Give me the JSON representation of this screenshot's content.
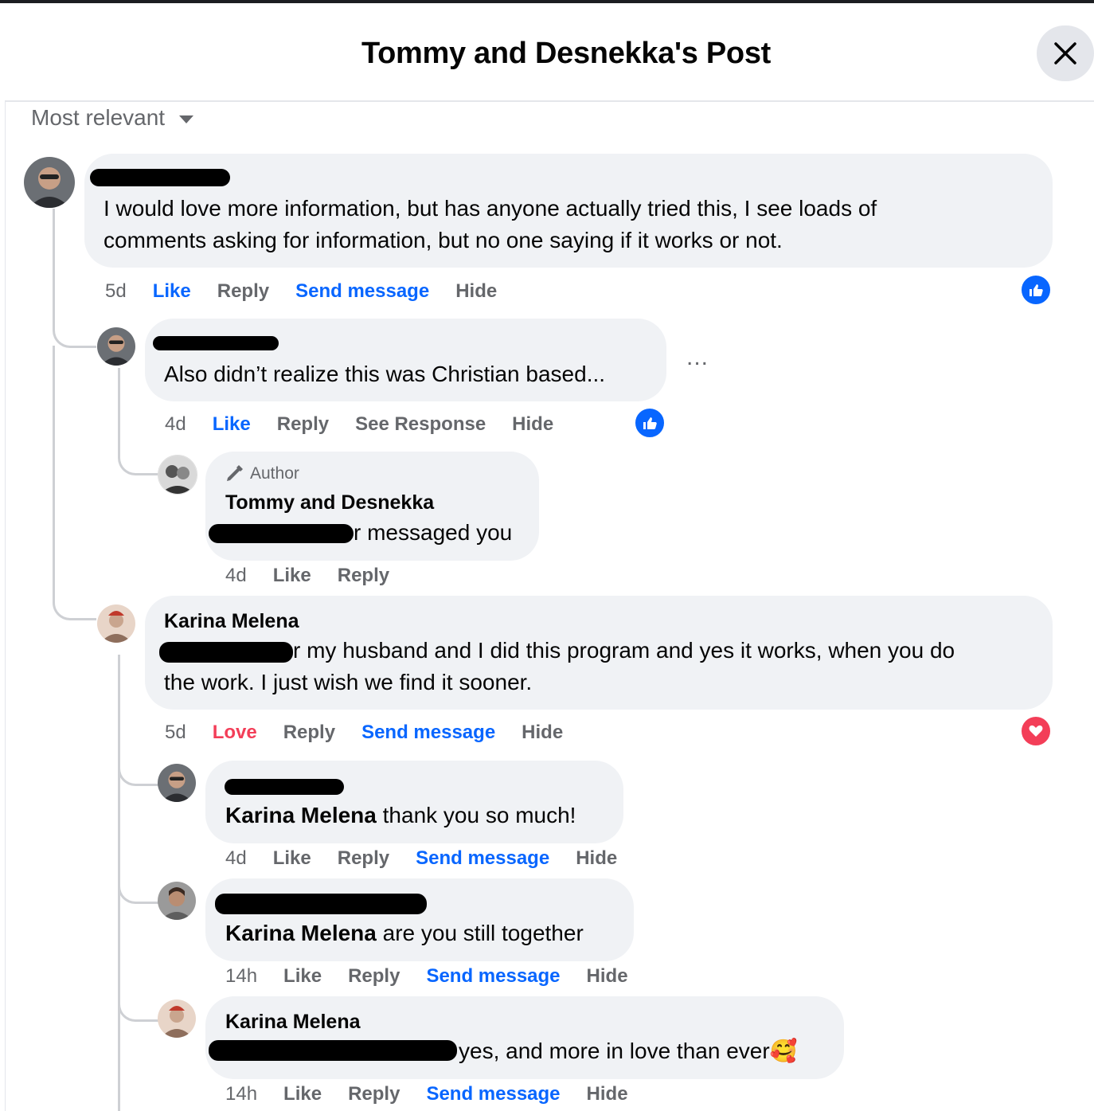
{
  "dialog": {
    "title": "Tommy and Desnekka's Post",
    "close_icon": "close-icon"
  },
  "sort": {
    "label": "Most relevant"
  },
  "comments": {
    "c1": {
      "line1": "I would love more information, but has anyone actually tried this, I see loads of",
      "line2": "comments asking for information, but no one saying if it works or not.",
      "time": "5d",
      "like": "Like",
      "reply": "Reply",
      "send": "Send message",
      "hide": "Hide",
      "reaction": "like"
    },
    "r1": {
      "text": "Also didn’t realize this was Christian based...",
      "time": "4d",
      "like": "Like",
      "reply": "Reply",
      "see": "See Response",
      "hide": "Hide",
      "reaction": "like",
      "more": "..."
    },
    "r2": {
      "badge": "Author",
      "name": "Tommy and Desnekka",
      "tail": "r messaged you",
      "time": "4d",
      "like": "Like",
      "reply": "Reply"
    },
    "c2": {
      "name": "Karina Melena",
      "line1": "r my husband and I did this program and yes it works, when you do",
      "line2": "the work. I just wish we find it sooner.",
      "time": "5d",
      "love": "Love",
      "reply": "Reply",
      "send": "Send message",
      "hide": "Hide",
      "reaction": "love"
    },
    "r3": {
      "mention": "Karina Melena",
      "text": " thank you so much!",
      "time": "4d",
      "like": "Like",
      "reply": "Reply",
      "send": "Send message",
      "hide": "Hide"
    },
    "r4": {
      "mention": "Karina Melena",
      "text": " are you still together",
      "time": "14h",
      "like": "Like",
      "reply": "Reply",
      "send": "Send message",
      "hide": "Hide"
    },
    "r5": {
      "name": "Karina Melena",
      "text": "yes, and more in love than ever",
      "emoji": "🥰",
      "time": "14h",
      "like": "Like",
      "reply": "Reply",
      "send": "Send message",
      "hide": "Hide"
    }
  },
  "colors": {
    "link_blue": "#0866ff",
    "love_red": "#f33e58",
    "bubble": "#f0f2f5",
    "meta": "#65676b"
  }
}
